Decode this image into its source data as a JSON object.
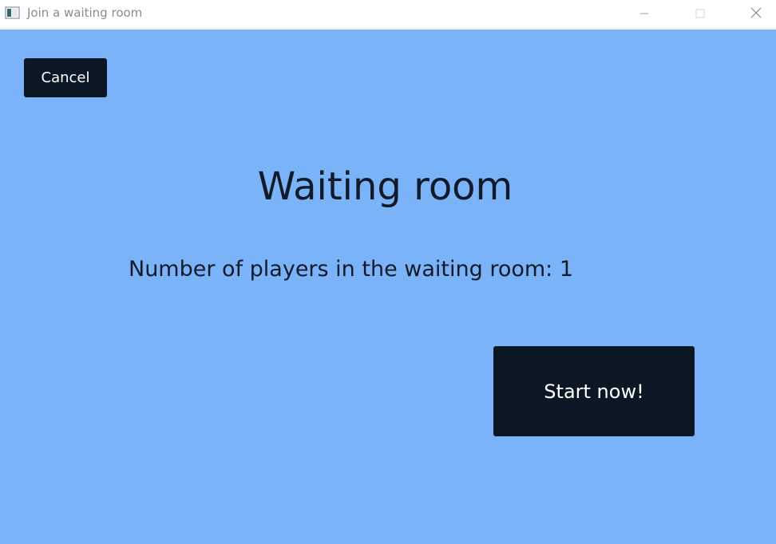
{
  "window": {
    "title": "Join a waiting room",
    "app_icon": "window-app-icon",
    "controls": {
      "minimize_icon": "minimize-icon",
      "maximize_icon": "maximize-icon",
      "close_icon": "close-icon"
    }
  },
  "main": {
    "cancel_label": "Cancel",
    "heading": "Waiting room",
    "players_label": "Number of players in the waiting room:",
    "players_count": "1",
    "start_label": "Start now!"
  },
  "colors": {
    "background": "#7ab3f7",
    "button": "#0c1726",
    "button_text": "#ffffff",
    "text": "#111a29"
  }
}
